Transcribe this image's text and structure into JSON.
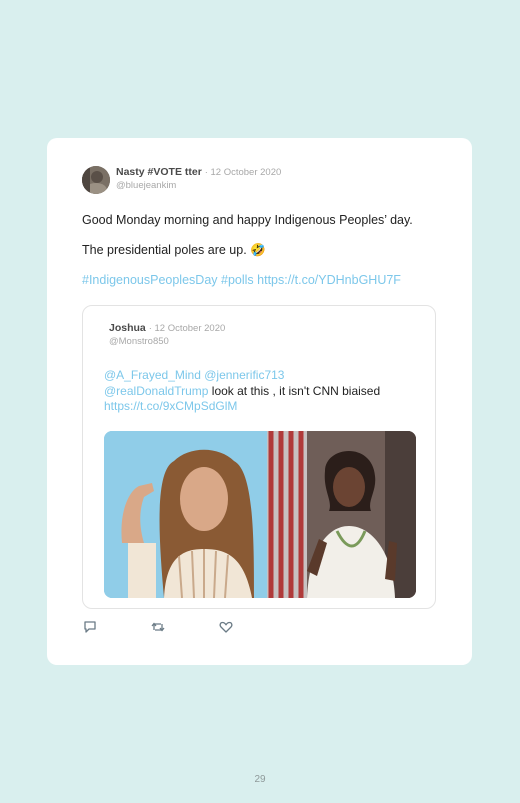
{
  "tweet": {
    "display_name": "Nasty #VOTE tter",
    "date": "· 12 October 2020",
    "handle": "@bluejeankim",
    "line1": "Good Monday morning and happy Indigenous Peoples’ day.",
    "line2": "The presidential poles are up. 🤣",
    "hashtags": "#IndigenousPeoplesDay #polls",
    "url": "https://t.co/YDHnbGHU7F"
  },
  "quoted": {
    "display_name": "Joshua",
    "date": "· 12 October 2020",
    "handle": "@Monstro850",
    "mention1": "@A_Frayed_Mind",
    "mention2": "@jennerific713",
    "mention3": "@realDonaldTrump",
    "text": " look at this , it isn't CNN biaised",
    "url": "https://t.co/9xCMpSdGlM"
  },
  "actions": {
    "reply_icon": "reply-icon",
    "retweet_icon": "retweet-icon",
    "like_icon": "heart-icon"
  },
  "page": {
    "number": "29"
  },
  "colors": {
    "background": "#d9efee",
    "link": "#7cc7ea",
    "card": "#ffffff"
  }
}
